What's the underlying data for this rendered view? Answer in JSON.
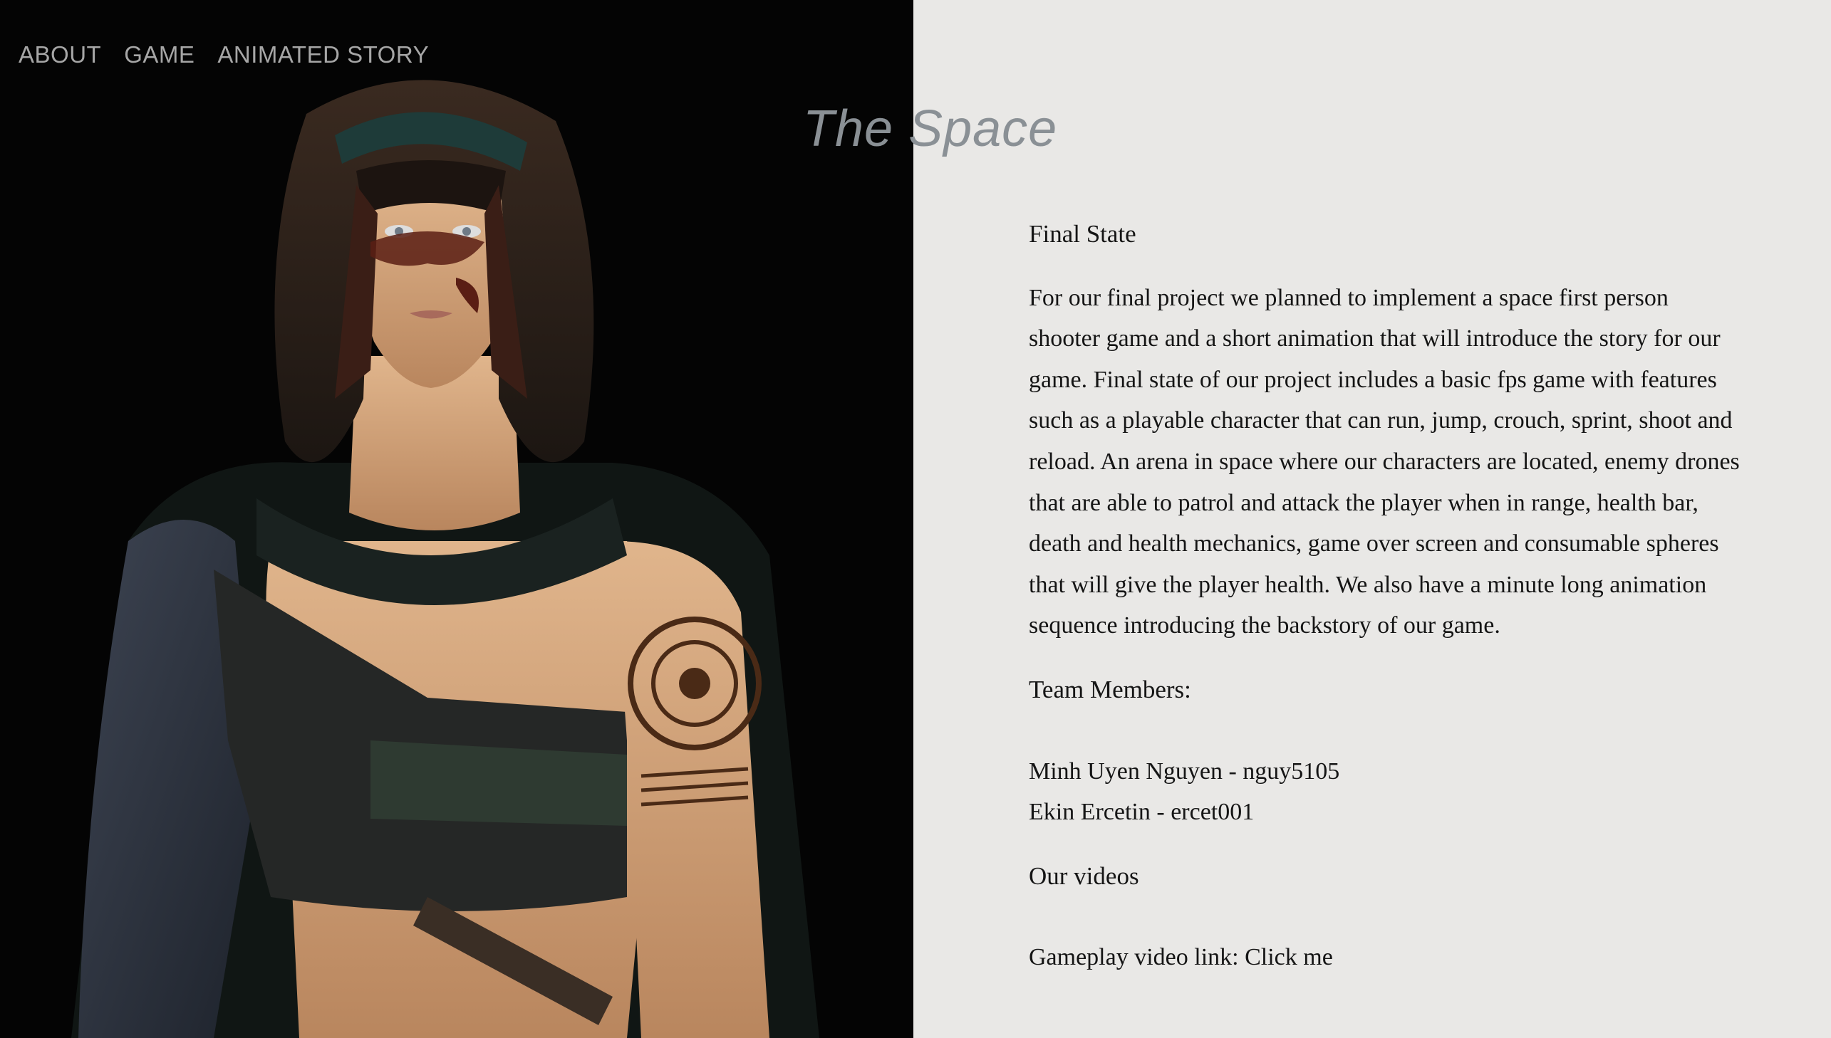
{
  "nav": {
    "items": [
      "ABOUT",
      "GAME",
      "ANIMATED STORY"
    ]
  },
  "site": {
    "title": "The Space"
  },
  "content": {
    "section_heading": "Final State",
    "paragraph": "For our final project we planned to implement a space first person shooter game and a short animation that will introduce the story for our game. Final state of our project includes a basic fps game with features such as a playable character that can run, jump, crouch, sprint, shoot and reload. An arena in space where our characters are located, enemy drones that are able to patrol and attack the player when in range, health bar, death and health mechanics, game over screen and consumable spheres that will give the player health. We also have a minute long animation sequence introducing the backstory of our game.",
    "team_heading": "Team Members:",
    "members": [
      "Minh Uyen Nguyen - nguy5105",
      "Ekin Ercetin - ercet001"
    ],
    "videos_heading": "Our videos",
    "gameplay_label": "Gameplay video link: ",
    "gameplay_link": "Click me"
  },
  "colors": {
    "left_background": "#040404",
    "right_background": "#e9e8e6",
    "nav_text": "#a6a6a6",
    "title_text": "#8a9095"
  }
}
